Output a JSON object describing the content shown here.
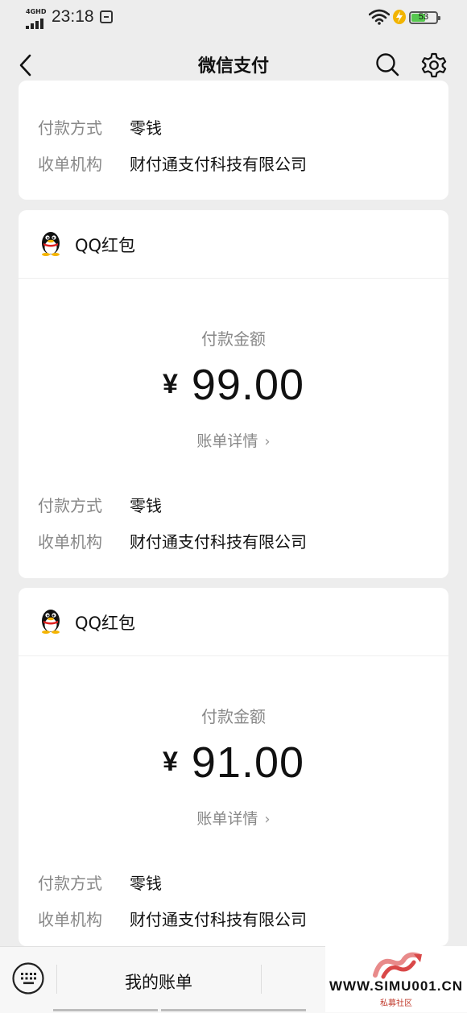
{
  "status_bar": {
    "network": "4GHD",
    "time": "23:18",
    "battery": "53",
    "battery_level": 0.53
  },
  "nav": {
    "title": "微信支付",
    "icons": [
      "back-arrow-icon",
      "search-icon",
      "gear-icon"
    ]
  },
  "labels": {
    "pay_method": "付款方式",
    "merchant": "收单机构",
    "amount_label": "付款金额",
    "bill_detail": "账单详情",
    "chevron": "›",
    "currency": "¥"
  },
  "top_card": {
    "pay_method_value": "零钱",
    "merchant_value": "财付通支付科技有限公司"
  },
  "transactions": [
    {
      "merchant_name": "QQ红包",
      "amount": "99.00",
      "pay_method_value": "零钱",
      "merchant_value": "财付通支付科技有限公司"
    },
    {
      "merchant_name": "QQ红包",
      "amount": "91.00",
      "pay_method_value": "零钱",
      "merchant_value": "财付通支付科技有限公司"
    }
  ],
  "bottom_bar": {
    "my_bill": "我的账单"
  },
  "watermark": {
    "site": "WWW.SIMU001.CN",
    "sub": "私募社区"
  },
  "colors": {
    "background": "#ededed",
    "card": "#ffffff",
    "muted_text": "#888888",
    "primary_text": "#111111"
  }
}
